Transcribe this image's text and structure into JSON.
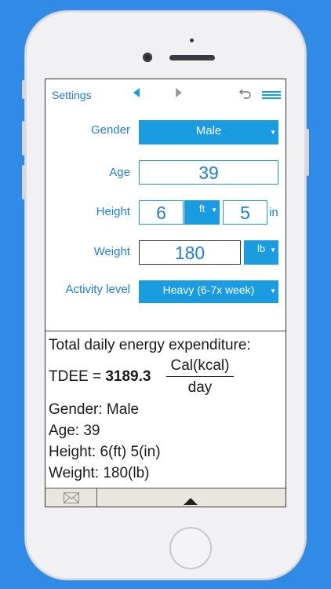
{
  "topbar": {
    "settings_label": "Settings",
    "prev_icon": "triangle-left",
    "next_icon": "triangle-right",
    "undo_icon": "undo-arrow",
    "menu_icon": "hamburger-menu"
  },
  "form": {
    "gender": {
      "label": "Gender",
      "value": "Male"
    },
    "age": {
      "label": "Age",
      "value": "39"
    },
    "height": {
      "label": "Height",
      "feet": "6",
      "unit_select": "ft",
      "inches": "5",
      "inch_unit": "in"
    },
    "weight": {
      "label": "Weight",
      "value": "180",
      "unit_select": "lb"
    },
    "activity": {
      "label": "Activity level",
      "value": "Heavy (6-7x week)"
    }
  },
  "results": {
    "heading": "Total daily energy expenditure:",
    "tdee_prefix": "TDEE = ",
    "tdee_value": "3189.3",
    "unit_numerator": "Cal(kcal)",
    "unit_denominator": "day",
    "gender_line": "Gender: Male",
    "age_line": "Age: 39",
    "height_line": "Height: 6(ft) 5(in)",
    "weight_line": "Weight: 180(lb)"
  },
  "bottombar": {
    "mail_icon": "envelope",
    "expand_icon": "triangle-up"
  },
  "colors": {
    "background": "#2f8be6",
    "accent": "#1a9ce0",
    "label": "#1f7fd0"
  }
}
